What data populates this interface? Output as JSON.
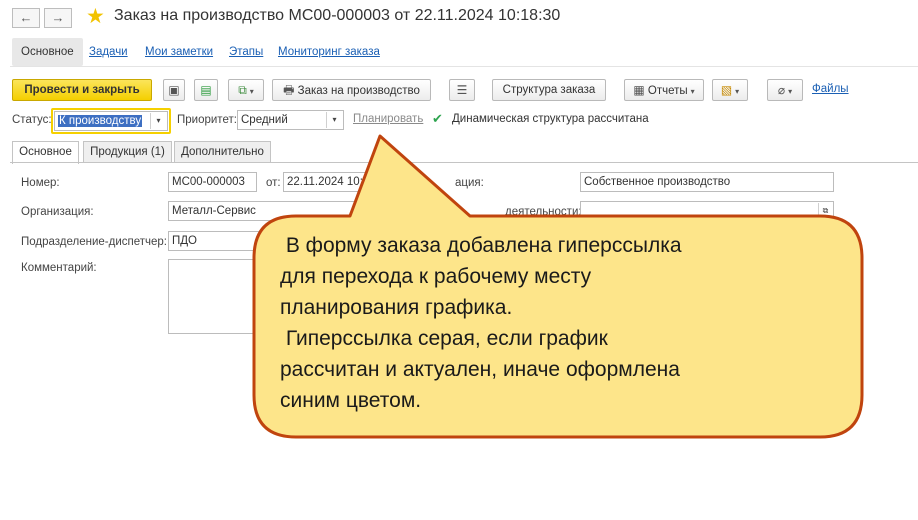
{
  "header": {
    "back_icon": "←",
    "forward_icon": "→",
    "title": "Заказ на производство МС00-000003 от 22.11.2024 10:18:30"
  },
  "nav_tabs": [
    "Основное",
    "Задачи",
    "Мои заметки",
    "Этапы",
    "Мониторинг заказа"
  ],
  "toolbar": {
    "post_close": "Провести и закрыть",
    "order_button": "Заказ на производство",
    "structure_button": "Структура заказа",
    "reports_button": "Отчеты",
    "files_link": "Файлы"
  },
  "status_row": {
    "status_label": "Статус:",
    "status_value": "К производству",
    "priority_label": "Приоритет:",
    "priority_value": "Средний",
    "plan_link": "Планировать",
    "plan_status": "Динамическая структура рассчитана"
  },
  "inner_tabs": [
    "Основное",
    "Продукция (1)",
    "Дополнительно"
  ],
  "form": {
    "number_label": "Номер:",
    "number_value": "МС00-000003",
    "date_label": "от:",
    "date_value": "22.11.2024 10:1",
    "source_label_tail": "ация:",
    "source_value": "Собственное производство",
    "org_label": "Организация:",
    "org_value": "Металл-Сервис",
    "activity_label_tail": "деятельности:",
    "dept_label": "Подразделение-диспетчер:",
    "dept_value": "ПДО",
    "comment_label": "Комментарий:"
  },
  "callout": {
    "lines": [
      " В форму заказа добавлена гиперссылка",
      "для перехода к рабочему месту",
      "планирования графика.",
      " Гиперссылка серая, если график",
      "рассчитан и актуален, иначе оформлена",
      "синим цветом."
    ]
  },
  "colors": {
    "accent_yellow": "#f4cf00",
    "link_blue": "#1a5fb4",
    "callout_fill": "#fde58a",
    "callout_border": "#c0440e",
    "selection_blue": "#3d6fc2"
  }
}
